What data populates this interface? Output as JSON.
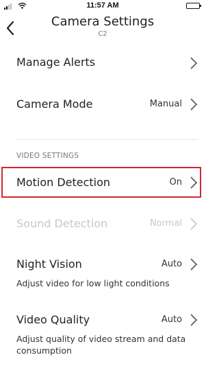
{
  "status_bar": {
    "time": "11:57 AM"
  },
  "header": {
    "title": "Camera Settings",
    "subtitle": "C2"
  },
  "rows": {
    "manage_alerts": {
      "label": "Manage Alerts"
    },
    "camera_mode": {
      "label": "Camera Mode",
      "value": "Manual"
    },
    "motion_detection": {
      "label": "Motion Detection",
      "value": "On"
    },
    "sound_detection": {
      "label": "Sound Detection",
      "value": "Normal"
    },
    "night_vision": {
      "label": "Night Vision",
      "value": "Auto",
      "description": "Adjust video for low light conditions"
    },
    "video_quality": {
      "label": "Video Quality",
      "value": "Auto",
      "description": "Adjust quality of video stream and data consumption"
    }
  },
  "sections": {
    "video_settings": "VIDEO SETTINGS"
  },
  "colors": {
    "highlight_border": "#d1262e",
    "disabled_text": "#c8c8c8",
    "chevron": "#555555"
  },
  "icons": [
    "signal-icon",
    "wifi-icon",
    "battery-icon",
    "back-chevron-icon",
    "chevron-right-icon"
  ]
}
